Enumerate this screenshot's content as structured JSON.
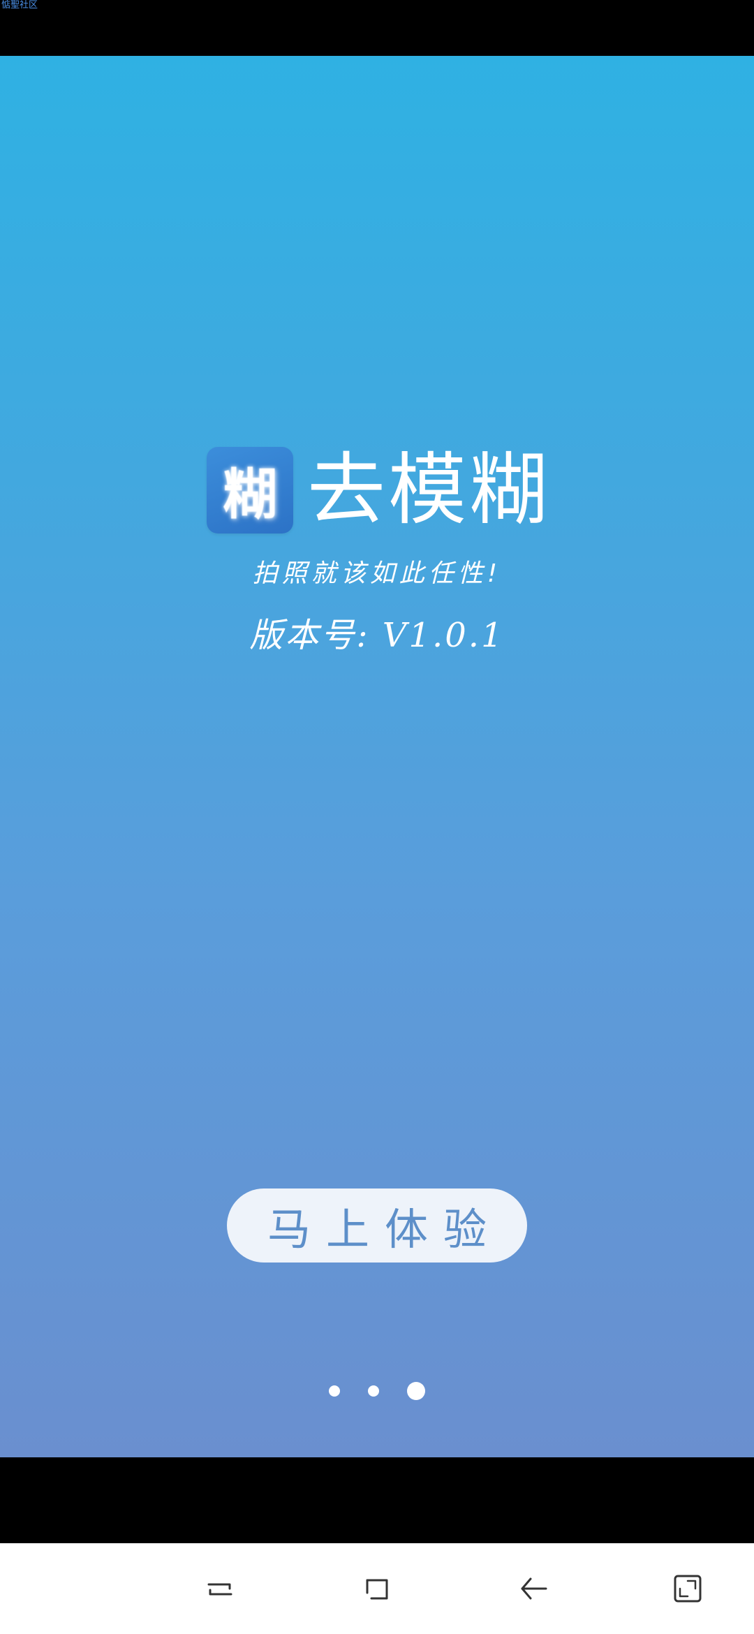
{
  "status_bar": {
    "label": "惦聖社区"
  },
  "splash": {
    "app_icon_glyph": "糊",
    "app_title": "去模糊",
    "slogan": "拍照就该如此任性!",
    "version": "版本号: V1.0.1",
    "start_button_label": "马上体验",
    "pager": {
      "pages": 3,
      "active_index": 2
    },
    "gradient_colors": [
      "#2fb1e3",
      "#42a8df",
      "#5a9ddb",
      "#6a8fcf"
    ]
  },
  "navigation_bar": {
    "buttons": [
      "recent-apps-icon",
      "home-icon",
      "back-icon",
      "fullscreen-icon"
    ]
  },
  "colors": {
    "button_bg": "#eef3fa",
    "button_text": "#5d8fc9",
    "nav_icon": "#333333"
  }
}
